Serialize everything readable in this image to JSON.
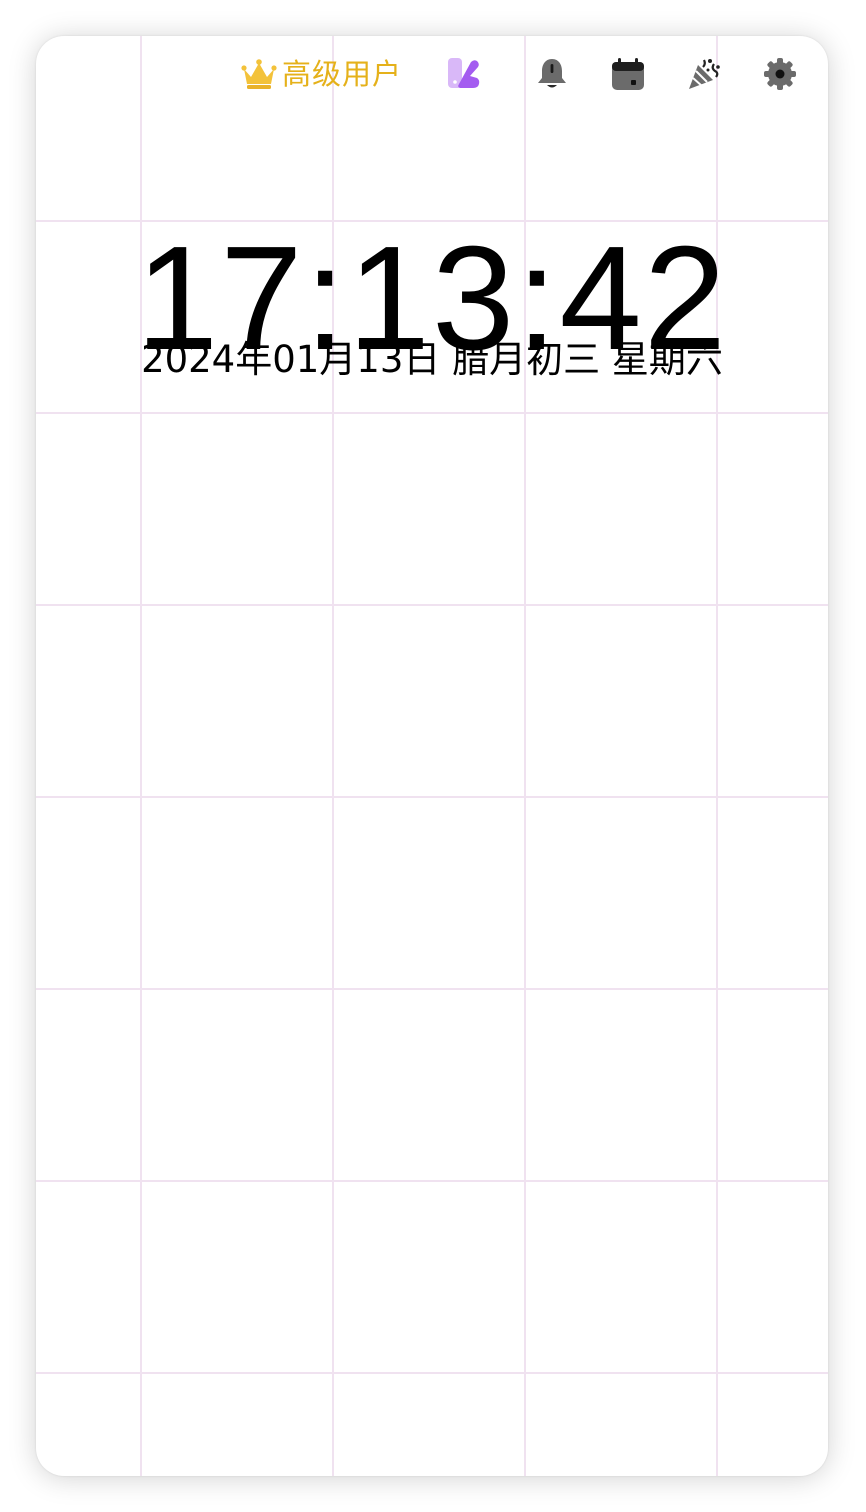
{
  "toolbar": {
    "premium_label": "高级用户",
    "icons": [
      "crown-icon",
      "widget-icon",
      "bell-icon",
      "calendar-icon",
      "party-icon",
      "gear-icon"
    ]
  },
  "clock": {
    "time": "17:13:42",
    "date_line": "2024年01月13日 腊月初三 星期六"
  },
  "colors": {
    "premium_gold": "#e5b11a",
    "grid_line": "#f0e2f0",
    "widget_purple": "#b06cf0",
    "icon_gray": "#6b6b6b"
  }
}
